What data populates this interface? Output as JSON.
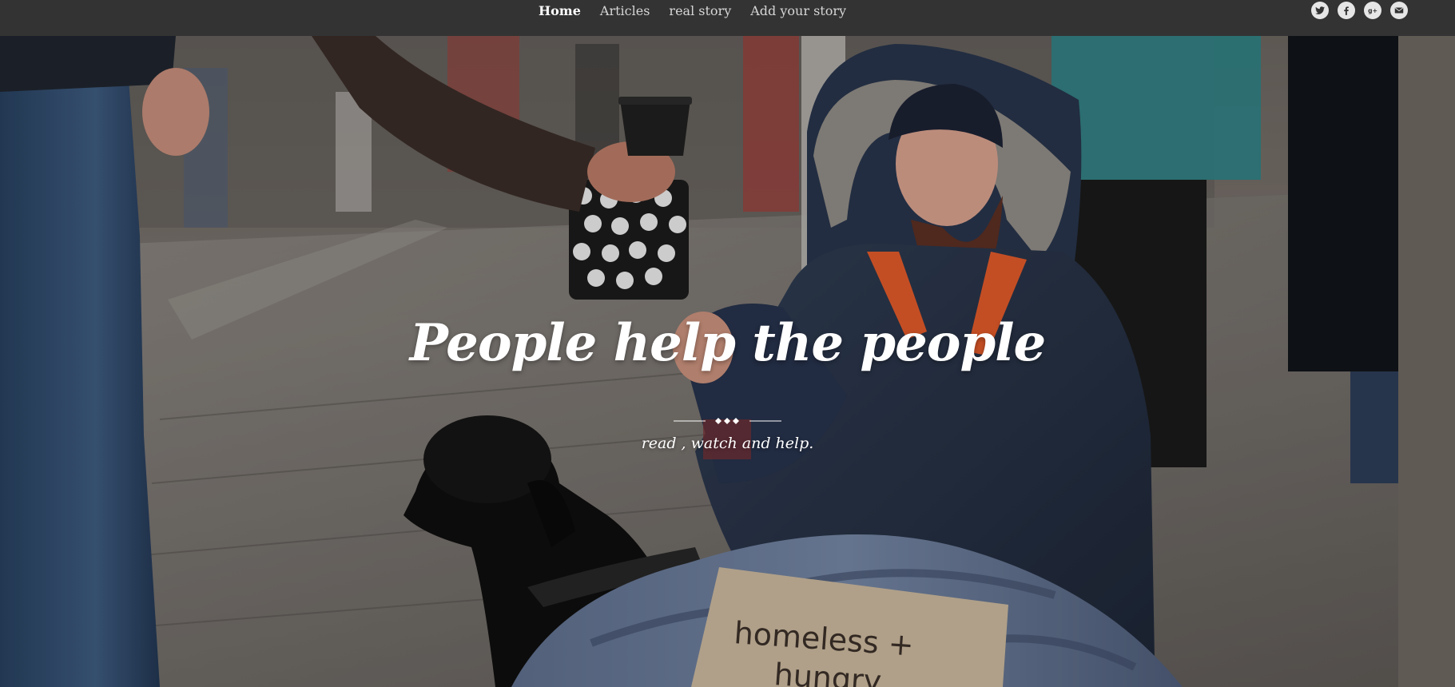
{
  "nav": {
    "items": [
      {
        "label": "Home",
        "active": true
      },
      {
        "label": "Articles",
        "active": false
      },
      {
        "label": "real story",
        "active": false
      },
      {
        "label": "Add your story",
        "active": false
      }
    ]
  },
  "social": {
    "icons": [
      "twitter-icon",
      "facebook-icon",
      "google-plus-icon",
      "email-icon"
    ]
  },
  "hero": {
    "title": "People help the people",
    "subtitle": "read , watch and help.",
    "sign_text_line1": "homeless +",
    "sign_text_line2": "hungry"
  },
  "colors": {
    "navbar": "#333333",
    "nav_text": "#d6d6d6",
    "hero_text": "#ffffff"
  }
}
